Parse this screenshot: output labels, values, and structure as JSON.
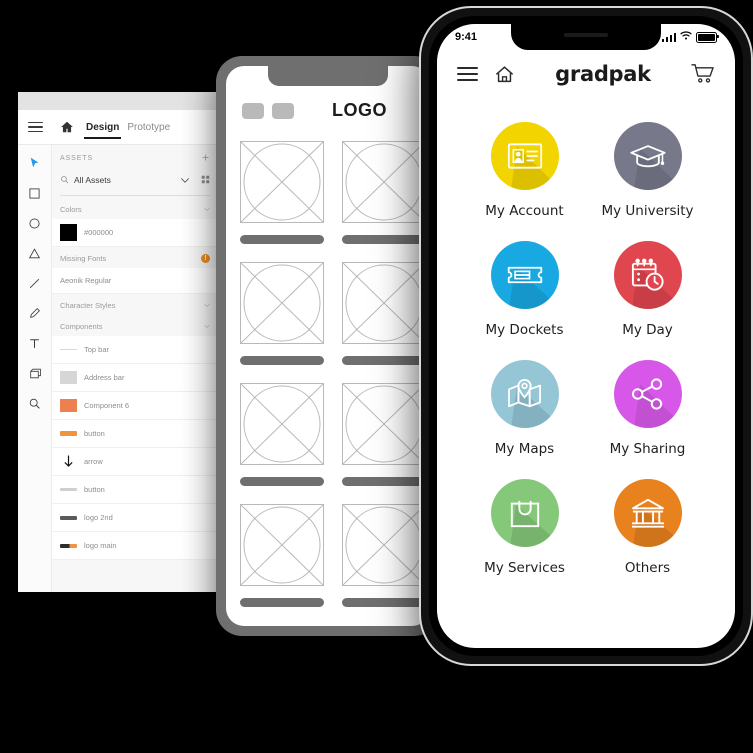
{
  "design_panel": {
    "menu_icon": "hamburger-icon",
    "home_icon": "home-icon",
    "tabs": [
      {
        "label": "Design",
        "active": true
      },
      {
        "label": "Prototype",
        "active": false
      }
    ],
    "tools": [
      "pointer-tool",
      "rectangle-tool",
      "ellipse-tool",
      "triangle-tool",
      "line-tool",
      "pen-tool",
      "text-tool",
      "artboard-tool",
      "zoom-tool"
    ],
    "assets_header": "ASSETS",
    "add_icon": "plus-icon",
    "search_value": "All Assets",
    "search_icon": "search-icon",
    "dropdown_icon": "chevron-down-icon",
    "grid_icon": "grid-view-icon",
    "groups": [
      {
        "title": "Colors",
        "rows": [
          {
            "label": "#000000",
            "swatch": "#000000"
          }
        ]
      },
      {
        "title": "Missing Fonts",
        "warning": "!",
        "rows": [
          {
            "label": "Aeonik Regular"
          }
        ]
      },
      {
        "title": "Character Styles",
        "rows": []
      },
      {
        "title": "Components",
        "rows": [
          {
            "label": "Top bar",
            "thumb": "topbar"
          },
          {
            "label": "Address bar",
            "thumb": "addressbar"
          },
          {
            "label": "Component 6",
            "thumb": "orange"
          },
          {
            "label": "button",
            "thumb": "btn-orange"
          },
          {
            "label": "arrow",
            "thumb": "arrow"
          },
          {
            "label": "button",
            "thumb": "btn-grey"
          },
          {
            "label": "logo 2nd",
            "thumb": "logo2"
          },
          {
            "label": "logo main",
            "thumb": "logomain"
          }
        ]
      }
    ]
  },
  "wireframe": {
    "logo_text": "LOGO",
    "chip_count": 2,
    "placeholder_count": 8
  },
  "phone": {
    "status": {
      "time": "9:41",
      "signal_icon": "cellular-bars-icon",
      "wifi_icon": "wifi-icon",
      "battery_icon": "battery-full-icon"
    },
    "appbar": {
      "menu_icon": "hamburger-icon",
      "home_icon": "home-icon",
      "brand": "gradpak",
      "cart_icon": "shopping-cart-icon"
    },
    "tiles": [
      {
        "label": "My Account",
        "color": "#f2d400",
        "shadow": "#d4bb00",
        "icon": "id-card-icon"
      },
      {
        "label": "My University",
        "color": "#77798a",
        "shadow": "#64667a",
        "icon": "graduation-cap-icon"
      },
      {
        "label": "My Dockets",
        "color": "#19a9e2",
        "shadow": "#1390c2",
        "icon": "ticket-icon"
      },
      {
        "label": "My Day",
        "color": "#e0464e",
        "shadow": "#c53a43",
        "icon": "calendar-clock-icon"
      },
      {
        "label": "My Maps",
        "color": "#94c6d6",
        "shadow": "#7fb2c4",
        "icon": "map-pin-icon"
      },
      {
        "label": "My Sharing",
        "color": "#d758e8",
        "shadow": "#bd47cd",
        "icon": "share-nodes-icon"
      },
      {
        "label": "My Services",
        "color": "#86c87a",
        "shadow": "#70b267",
        "icon": "shopping-bag-icon"
      },
      {
        "label": "Others",
        "color": "#e8821f",
        "shadow": "#cc6e14",
        "icon": "bank-building-icon"
      }
    ]
  }
}
